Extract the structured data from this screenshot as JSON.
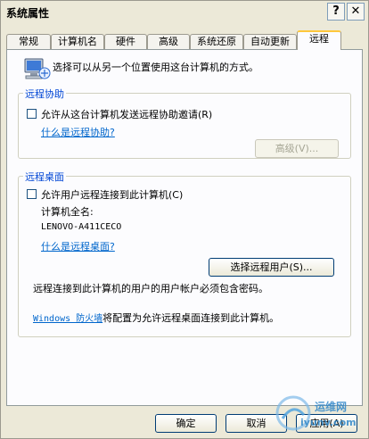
{
  "window": {
    "title": "系统属性",
    "help_glyph": "?",
    "close_glyph": "✕"
  },
  "tabs": [
    "常规",
    "计算机名",
    "硬件",
    "高级",
    "系统还原",
    "自动更新",
    "远程"
  ],
  "active_tab": "远程",
  "intro": "选择可以从另一个位置使用这台计算机的方式。",
  "assist": {
    "legend": "远程协助",
    "checkbox_label": "允许从这台计算机发送远程协助邀请(R)",
    "link": "什么是远程协助?",
    "advanced_button": "高级(V)..."
  },
  "desktop": {
    "legend": "远程桌面",
    "checkbox_label": "允许用户远程连接到此计算机(C)",
    "fullname_label": "计算机全名:",
    "fullname_value": "LENOVO-A411CECO",
    "link": "什么是远程桌面?",
    "select_users_button": "选择远程用户(S)...",
    "password_note": "远程连接到此计算机的用户的用户帐户必须包含密码。",
    "firewall_link": "Windows 防火墙",
    "firewall_text": "将配置为允许远程桌面连接到此计算机。"
  },
  "footer": {
    "ok": "确定",
    "cancel": "取消",
    "apply": "应用(A)"
  },
  "watermark": {
    "line1": "运维网",
    "line2": "iyunv.com"
  },
  "colors": {
    "accent_tab": "#ffc83c",
    "legend": "#0046d5",
    "link": "#0066cc"
  }
}
